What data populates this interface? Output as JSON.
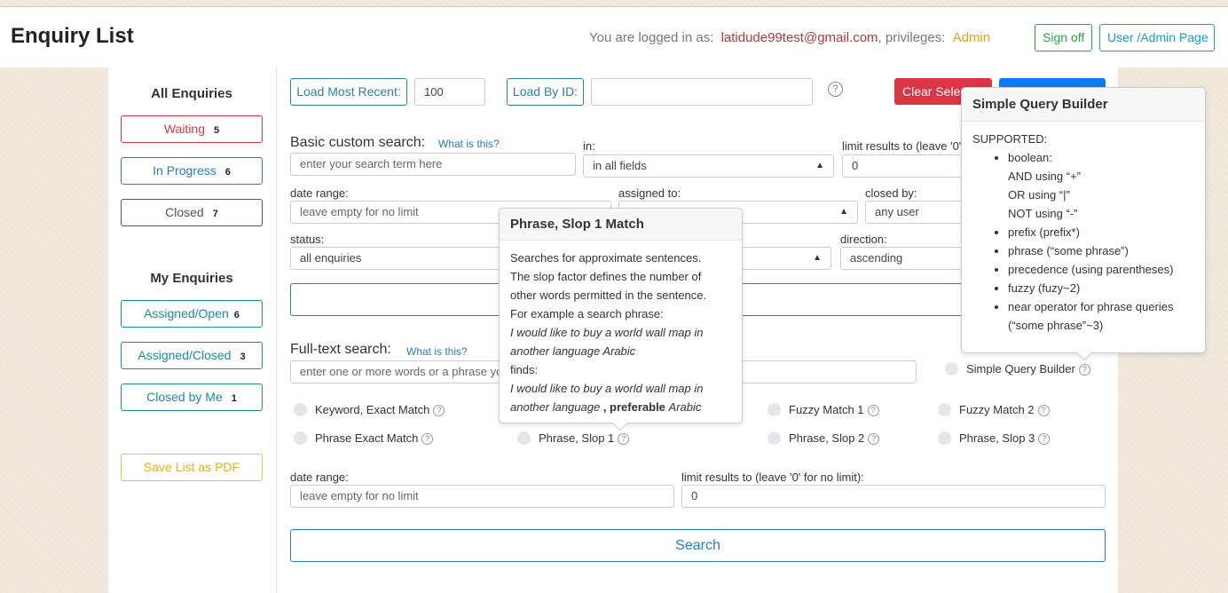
{
  "header": {
    "title": "Enquiry List",
    "login_prefix": "You are logged in as:",
    "email": "latidude99test@gmail.com",
    "privileges_label": ", privileges:",
    "privileges_value": "Admin",
    "sign_off": "Sign off",
    "user_admin": "User /Admin Page"
  },
  "sidebar": {
    "all_heading": "All Enquiries",
    "all_items": [
      {
        "label": "Waiting",
        "count": "5"
      },
      {
        "label": "In Progress",
        "count": "6"
      },
      {
        "label": "Closed",
        "count": "7"
      }
    ],
    "my_heading": "My Enquiries",
    "my_items": [
      {
        "label": "Assigned/Open",
        "count": "6"
      },
      {
        "label": "Assigned/Closed",
        "count": "3"
      },
      {
        "label": "Closed by Me",
        "count": "1"
      }
    ],
    "save_pdf": "Save List as PDF"
  },
  "toolbar": {
    "load_recent": "Load Most Recent:",
    "recent_value": "100",
    "load_by_id": "Load By ID:",
    "id_value": "",
    "clear_selection": "Clear Selection"
  },
  "basic_search": {
    "heading": "Basic custom search:",
    "whatis": "What is this?",
    "term_placeholder": "enter your search term here",
    "in_label": "in:",
    "in_value": "in all fields",
    "limit_label": "limit results to (leave '0' for no limit):",
    "limit_value": "0",
    "date_label": "date range:",
    "date_placeholder": "leave empty for no limit",
    "assigned_label": "assigned to:",
    "closed_by_label": "closed by:",
    "closed_by_value": "any user",
    "status_label": "status:",
    "status_value": "all enquiries",
    "direction_label": "direction:",
    "direction_value": "ascending"
  },
  "fulltext": {
    "heading": "Full-text search:",
    "whatis": "What is this?",
    "placeholder": "enter one or more words or a phrase you want to search for",
    "sqb_label": "Simple Query Builder",
    "options": [
      "Keyword, Exact Match",
      "Phrase Exact Match",
      "Phrase, Slop 1",
      "Fuzzy Match 1",
      "Phrase, Slop 2",
      "Fuzzy Match 2",
      "Phrase, Slop 3"
    ],
    "date_label": "date range:",
    "date_placeholder": "leave empty for no limit",
    "limit_label": "limit results to (leave '0' for no limit):",
    "limit_value": "0",
    "search": "Search"
  },
  "popover_slop": {
    "title": "Phrase, Slop 1 Match",
    "line1": "Searches for approximate sentences.",
    "line2": "The slop factor defines the number of",
    "line3": "other words permitted in the sentence.",
    "line4": "For example a search phrase:",
    "example1a": "I would like to buy a world wall map in",
    "example1b": "another language Arabic",
    "finds": "finds:",
    "example2a": "I would like to buy a world wall map in",
    "example2b_pre": "another language",
    "example2b_bold": ", preferable",
    "example2b_post": "Arabic"
  },
  "popover_sqb": {
    "title": "Simple Query Builder",
    "supported": "SUPPORTED:",
    "boolean": "boolean:",
    "and": "AND using “+”",
    "or": "OR using “|”",
    "not": "NOT using “-”",
    "prefix": "prefix (prefix*)",
    "phrase": "phrase (“some phrase”)",
    "precedence": "precedence (using parentheses)",
    "fuzzy": "fuzzy (fuzy~2)",
    "near": "near operator for phrase queries",
    "near2": "(“some phrase”~3)"
  },
  "colors": {
    "danger": "#dc3545",
    "primary": "#0d7cf2",
    "info": "#17a2b8",
    "success": "#28a745",
    "warning": "#f0b020"
  }
}
